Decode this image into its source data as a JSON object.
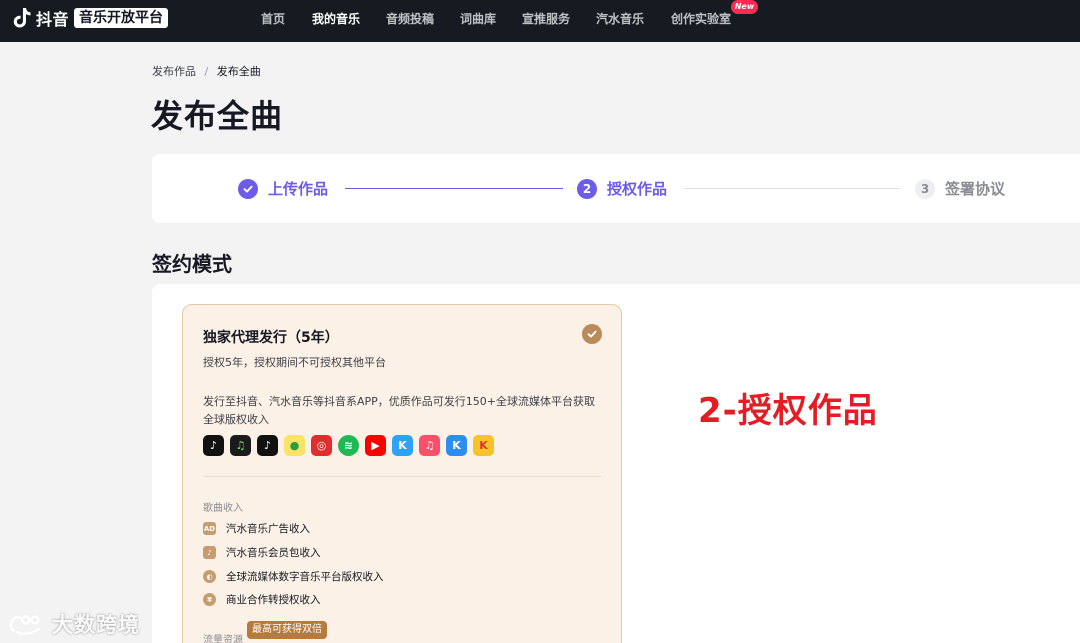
{
  "brand": {
    "name": "抖音",
    "badge": "音乐开放平台"
  },
  "nav": {
    "items": [
      "首页",
      "我的音乐",
      "音频投稿",
      "词曲库",
      "宣推服务",
      "汽水音乐",
      "创作实验室"
    ],
    "active": "我的音乐",
    "new_badge": "New"
  },
  "breadcrumb": {
    "parent": "发布作品",
    "separator": "/",
    "current": "发布全曲"
  },
  "page_title": "发布全曲",
  "stepper": {
    "steps": [
      {
        "number": "1",
        "label": "上传作品",
        "state": "done"
      },
      {
        "number": "2",
        "label": "授权作品",
        "state": "active"
      },
      {
        "number": "3",
        "label": "签署协议",
        "state": "todo"
      }
    ],
    "accent": "#6c5ce7"
  },
  "section_title": "签约模式",
  "card": {
    "title": "独家代理发行（5年）",
    "subtitle": "授权5年，授权期间不可授权其他平台",
    "description": "发行至抖音、汽水音乐等抖音系APP，优质作品可发行150+全球流媒体平台获取全球版权收入",
    "selected": true,
    "platforms": [
      {
        "icon": "douyin-icon",
        "color": "#111111"
      },
      {
        "icon": "qishui-music-icon",
        "color": "#1b1b1b"
      },
      {
        "icon": "douyin-lite-icon",
        "color": "#111111"
      },
      {
        "icon": "qq-music-icon",
        "color": "#f5d41b"
      },
      {
        "icon": "netease-music-icon",
        "color": "#e02d2d"
      },
      {
        "icon": "spotify-icon",
        "color": "#1db954"
      },
      {
        "icon": "youtube-music-icon",
        "color": "#ff0000"
      },
      {
        "icon": "kugou-icon",
        "color": "#2ca2f9"
      },
      {
        "icon": "apple-music-icon",
        "color": "#fb4f69"
      },
      {
        "icon": "kuwo-icon",
        "color": "#2d8df5"
      },
      {
        "icon": "kkbox-icon",
        "color": "#f5c42a"
      }
    ],
    "income_title": "歌曲收入",
    "income_items": [
      {
        "icon": "ad-icon",
        "glyph": "AD",
        "label": "汽水音乐广告收入"
      },
      {
        "icon": "member-icon",
        "glyph": "♪",
        "label": "汽水音乐会员包收入"
      },
      {
        "icon": "globe-icon",
        "glyph": "◐",
        "label": "全球流媒体数字音乐平台版权收入"
      },
      {
        "icon": "yen-icon",
        "glyph": "¥",
        "label": "商业合作转授权收入"
      }
    ],
    "flow_label": "流量资源",
    "flow_badge": "最高可获得双倍"
  },
  "annotation": "2-授权作品",
  "watermark": "大数跨境"
}
